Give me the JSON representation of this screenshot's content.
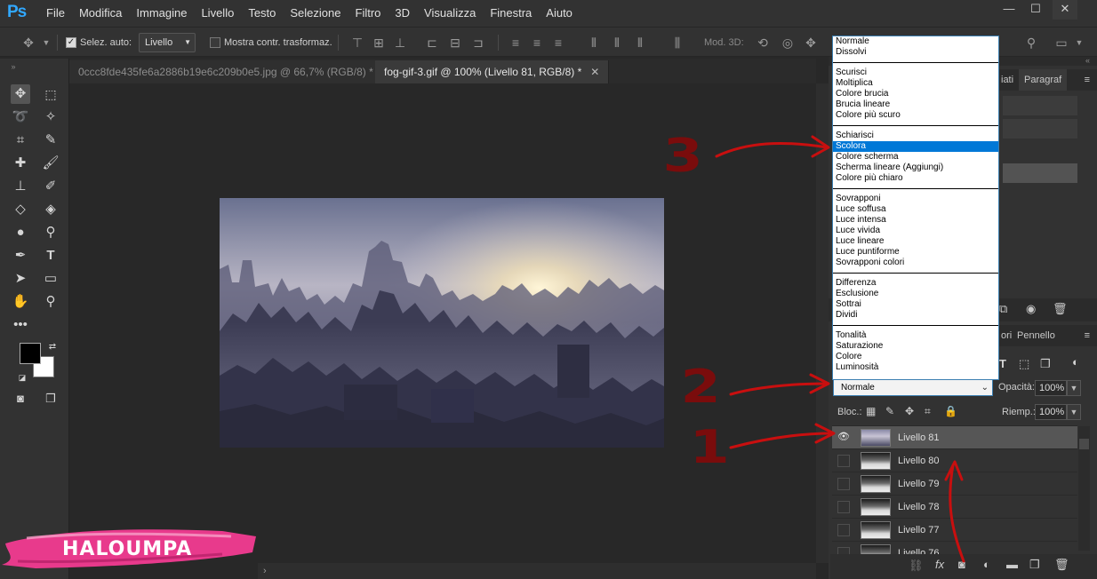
{
  "app": {
    "logo": "Ps"
  },
  "menubar": {
    "items": [
      "File",
      "Modifica",
      "Immagine",
      "Livello",
      "Testo",
      "Selezione",
      "Filtro",
      "3D",
      "Visualizza",
      "Finestra",
      "Aiuto"
    ]
  },
  "window_controls": {
    "minimize": "—",
    "maximize": "☐",
    "close": "✕"
  },
  "options_bar": {
    "auto_select_label": "Selez. auto:",
    "auto_select_checked": true,
    "auto_select_target": "Livello",
    "show_transform_label": "Mostra contr. trasformaz.",
    "show_transform_checked": false,
    "mode_3d_label": "Mod. 3D:"
  },
  "tabs": [
    {
      "label": "0ccc8fde435fe6a2886b19e6c209b0e5.jpg @ 66,7% (RGB/8) *",
      "active": false,
      "close": "✕"
    },
    {
      "label": "fog-gif-3.gif @ 100% (Livello 81, RGB/8) *",
      "active": true,
      "close": "✕"
    }
  ],
  "right_dock": {
    "panel_tabs": {
      "paragraph_partial": "iati",
      "paragraph": "Paragraf",
      "brush_partial": "ori",
      "brush": "Pennello"
    }
  },
  "blend_modes": {
    "groups": [
      [
        "Normale",
        "Dissolvi"
      ],
      [
        "Scurisci",
        "Moltiplica",
        "Colore brucia",
        "Brucia lineare",
        "Colore più scuro"
      ],
      [
        "Schiarisci",
        "Scolora",
        "Colore scherma",
        "Scherma lineare (Aggiungi)",
        "Colore più chiaro"
      ],
      [
        "Sovrapponi",
        "Luce soffusa",
        "Luce intensa",
        "Luce vivida",
        "Luce lineare",
        "Luce puntiforme",
        "Sovrapponi colori"
      ],
      [
        "Differenza",
        "Esclusione",
        "Sottrai",
        "Dividi"
      ],
      [
        "Tonalità",
        "Saturazione",
        "Colore",
        "Luminosità"
      ]
    ],
    "highlighted": "Scolora",
    "current_value": "Normale"
  },
  "layers_panel": {
    "opacity_label": "Opacità:",
    "opacity_value": "100%",
    "lock_label": "Bloc.:",
    "fill_label": "Riemp.:",
    "fill_value": "100%",
    "layers": [
      {
        "name": "Livello 81",
        "visible": true,
        "selected": true
      },
      {
        "name": "Livello 80",
        "visible": false,
        "selected": false
      },
      {
        "name": "Livello 79",
        "visible": false,
        "selected": false
      },
      {
        "name": "Livello 78",
        "visible": false,
        "selected": false
      },
      {
        "name": "Livello 77",
        "visible": false,
        "selected": false
      },
      {
        "name": "Livello 76",
        "visible": false,
        "selected": false
      }
    ]
  },
  "annotations": {
    "step1": "1",
    "step2": "2",
    "step3": "3"
  },
  "watermark": {
    "text": "HALOUMPA"
  },
  "colors": {
    "ui_bg": "#323232",
    "canvas_bg": "#282828",
    "accent": "#0078d7",
    "annotation_red": "#c80f0f",
    "annotation_dark_red": "#7a0c0c",
    "watermark_pink": "#e83a8c"
  }
}
